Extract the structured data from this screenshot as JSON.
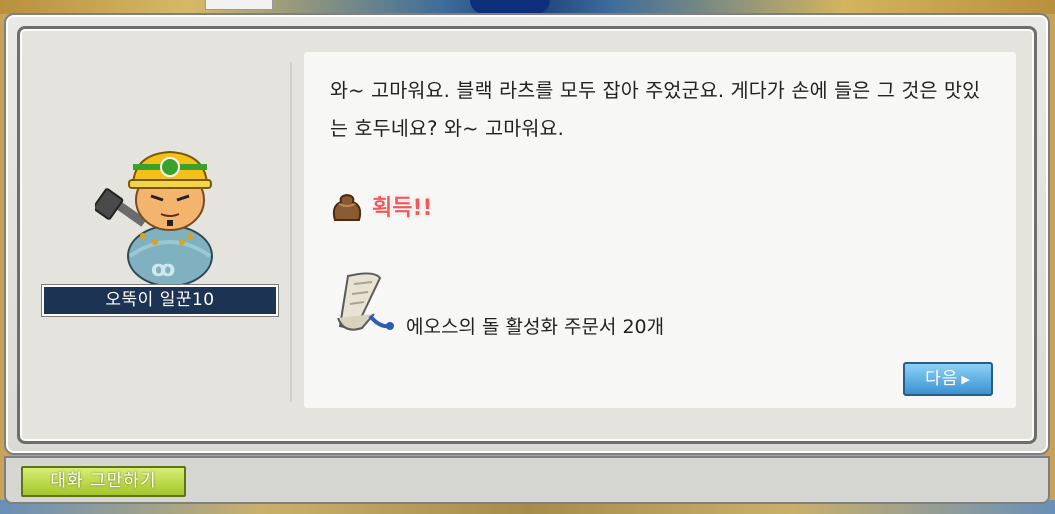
{
  "npc": {
    "name": "오뚝이 일꾼10"
  },
  "dialog": {
    "text": "와~ 고마워요. 블랙 라츠를 모두 잡아 주었군요. 게다가 손에 들은 그 것은 맛있는 호두네요? 와~ 고마워요."
  },
  "reward": {
    "title": "획득!!",
    "bag_icon": "bag-icon",
    "item_icon": "scroll-icon",
    "item_name": "에오스의 돌 활성화 주문서 20개"
  },
  "buttons": {
    "next_label": "다음",
    "end_chat_label": "대화 그만하기"
  },
  "colors": {
    "reward_title": "#ec5a5a",
    "next_button": "#3b92d1",
    "end_chat_button": "#a4c62b",
    "name_plate": "#1d3354"
  }
}
